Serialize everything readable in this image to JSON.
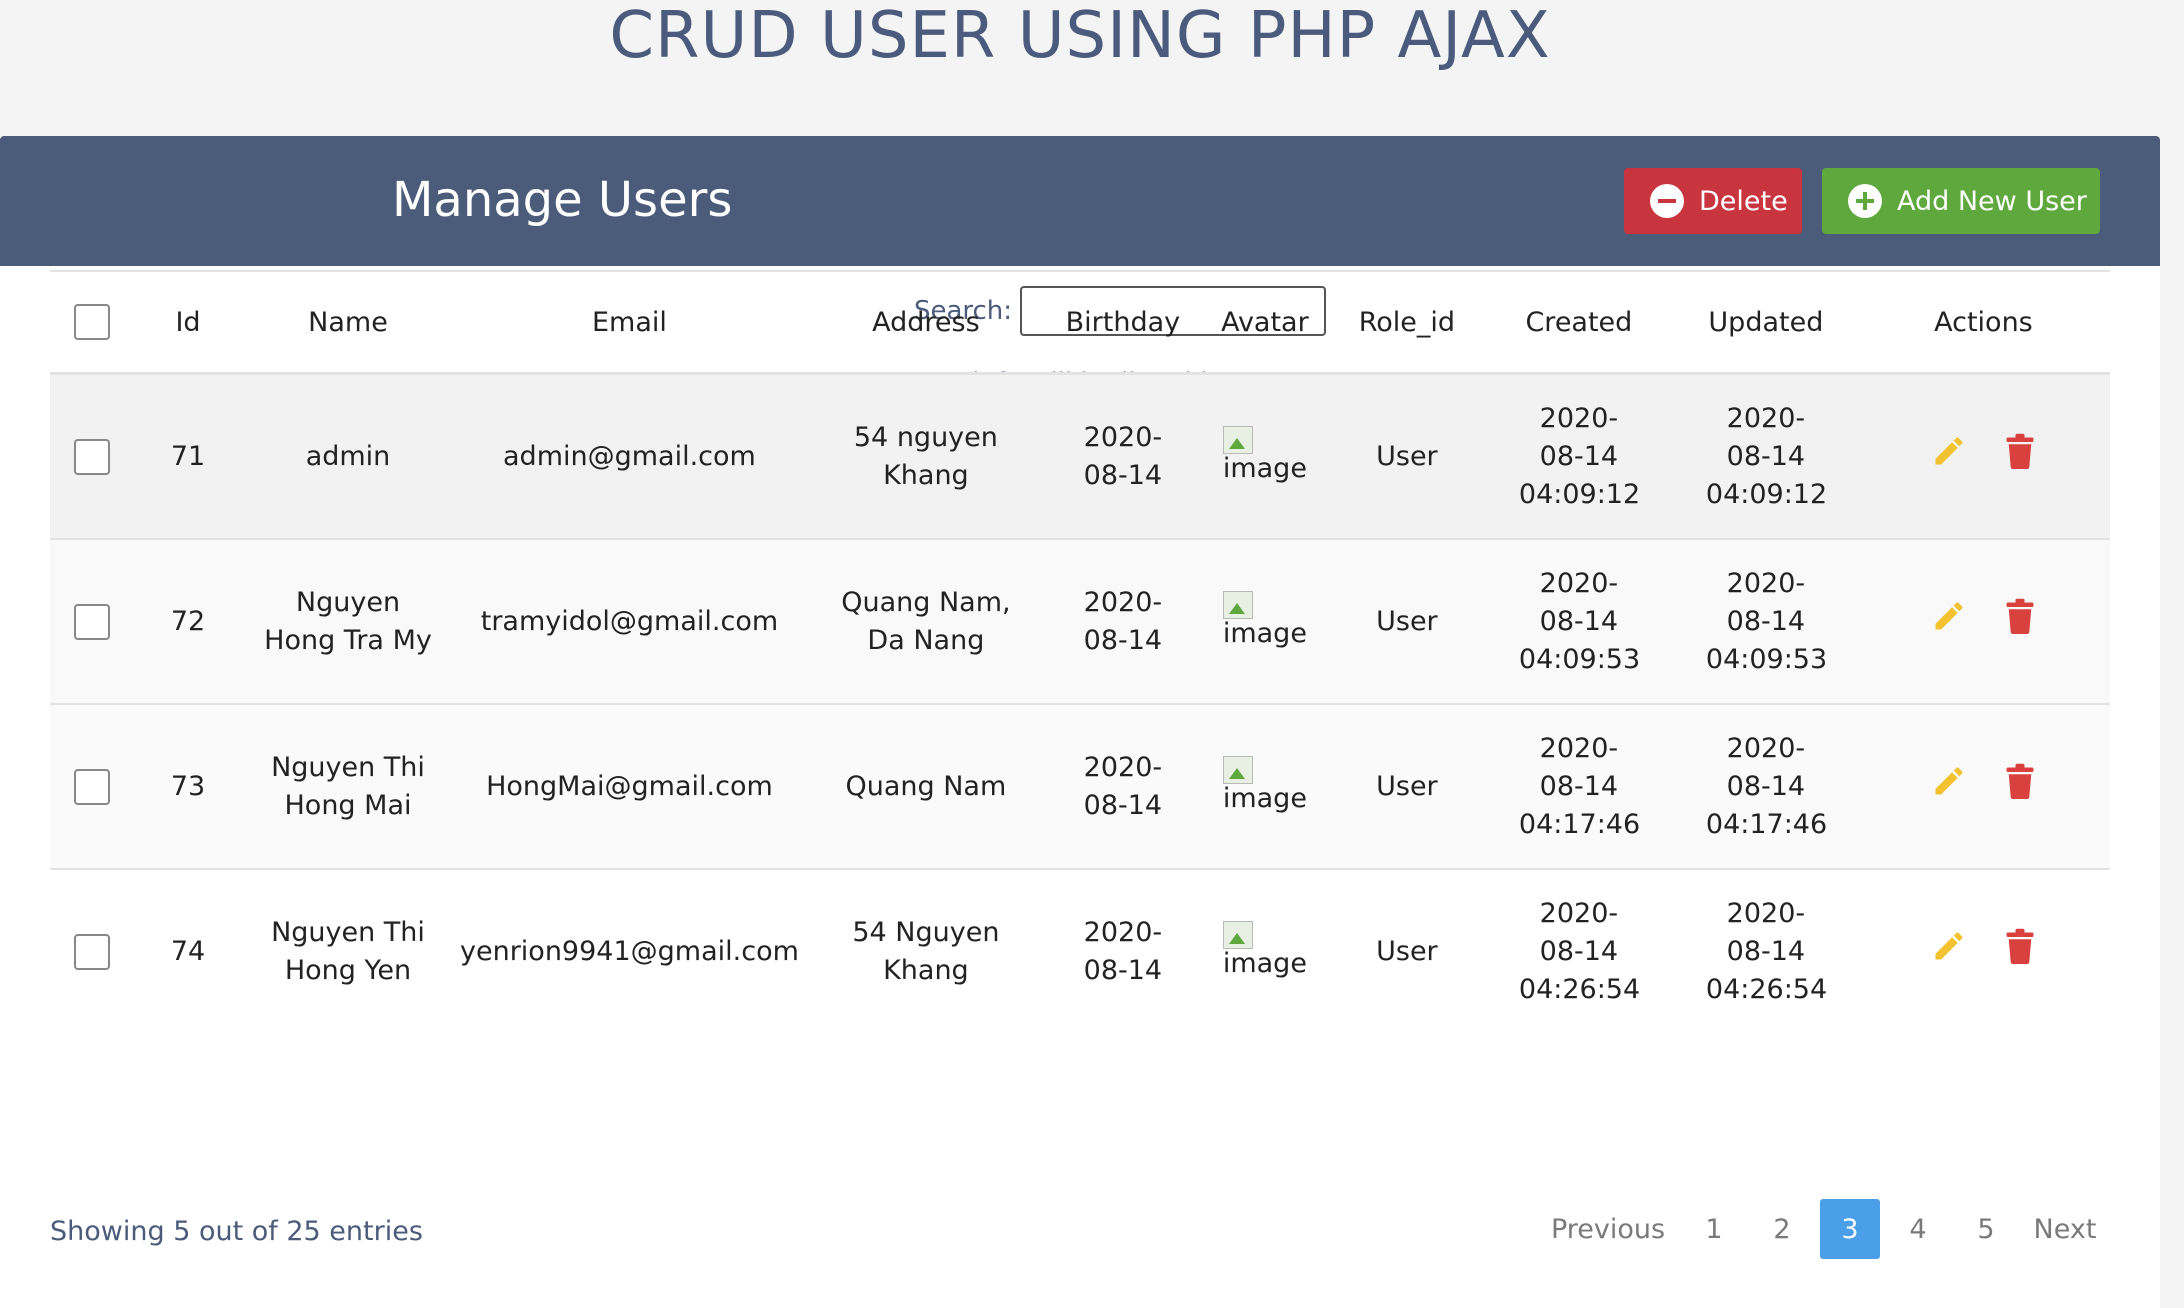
{
  "page_title": "CRUD USER USING PHP AJAX",
  "header": {
    "title": "Manage Users",
    "delete_label": "Delete",
    "add_label": "Add New User"
  },
  "search": {
    "label": "Search:",
    "value": ""
  },
  "info_text": "Person info will be listed here...",
  "columns": [
    "Id",
    "Name",
    "Email",
    "Address",
    "Birthday",
    "Avatar",
    "Role_id",
    "Created",
    "Updated",
    "Actions"
  ],
  "rows": [
    {
      "id": "71",
      "name": "admin",
      "email": "admin@gmail.com",
      "address": "54 nguyen Khang",
      "birthday": "2020-08-14",
      "avatar_alt": "image",
      "role": "User",
      "created": "2020-08-14 04:09:12",
      "updated": "2020-08-14 04:09:12"
    },
    {
      "id": "72",
      "name": "Nguyen Hong Tra My",
      "email": "tramyidol@gmail.com",
      "address": "Quang Nam, Da Nang",
      "birthday": "2020-08-14",
      "avatar_alt": "image",
      "role": "User",
      "created": "2020-08-14 04:09:53",
      "updated": "2020-08-14 04:09:53"
    },
    {
      "id": "73",
      "name": "Nguyen Thi Hong Mai",
      "email": "HongMai@gmail.com",
      "address": "Quang Nam",
      "birthday": "2020-08-14",
      "avatar_alt": "image",
      "role": "User",
      "created": "2020-08-14 04:17:46",
      "updated": "2020-08-14 04:17:46"
    },
    {
      "id": "74",
      "name": "Nguyen Thi Hong Yen",
      "email": "yenrion9941@gmail.com",
      "address": "54 Nguyen Khang",
      "birthday": "2020-08-14",
      "avatar_alt": "image",
      "role": "User",
      "created": "2020-08-14 04:26:54",
      "updated": "2020-08-14 04:26:54"
    }
  ],
  "footer": {
    "showing_text": "Showing 5 out of 25 entries"
  },
  "pagination": {
    "prev": "Previous",
    "pages": [
      "1",
      "2",
      "3",
      "4",
      "5"
    ],
    "active": "3",
    "next": "Next"
  },
  "colors": {
    "header_bg": "#4b5b7a",
    "delete": "#c9353e",
    "add": "#5ea83e",
    "edit_icon": "#f2c230",
    "trash_icon": "#d9413f",
    "active_page": "#4a9fe8"
  },
  "icons": {
    "delete_button": "minus-circle-icon",
    "add_button": "plus-circle-icon",
    "edit": "pencil-icon",
    "remove": "trash-icon",
    "avatar": "broken-image-icon"
  }
}
